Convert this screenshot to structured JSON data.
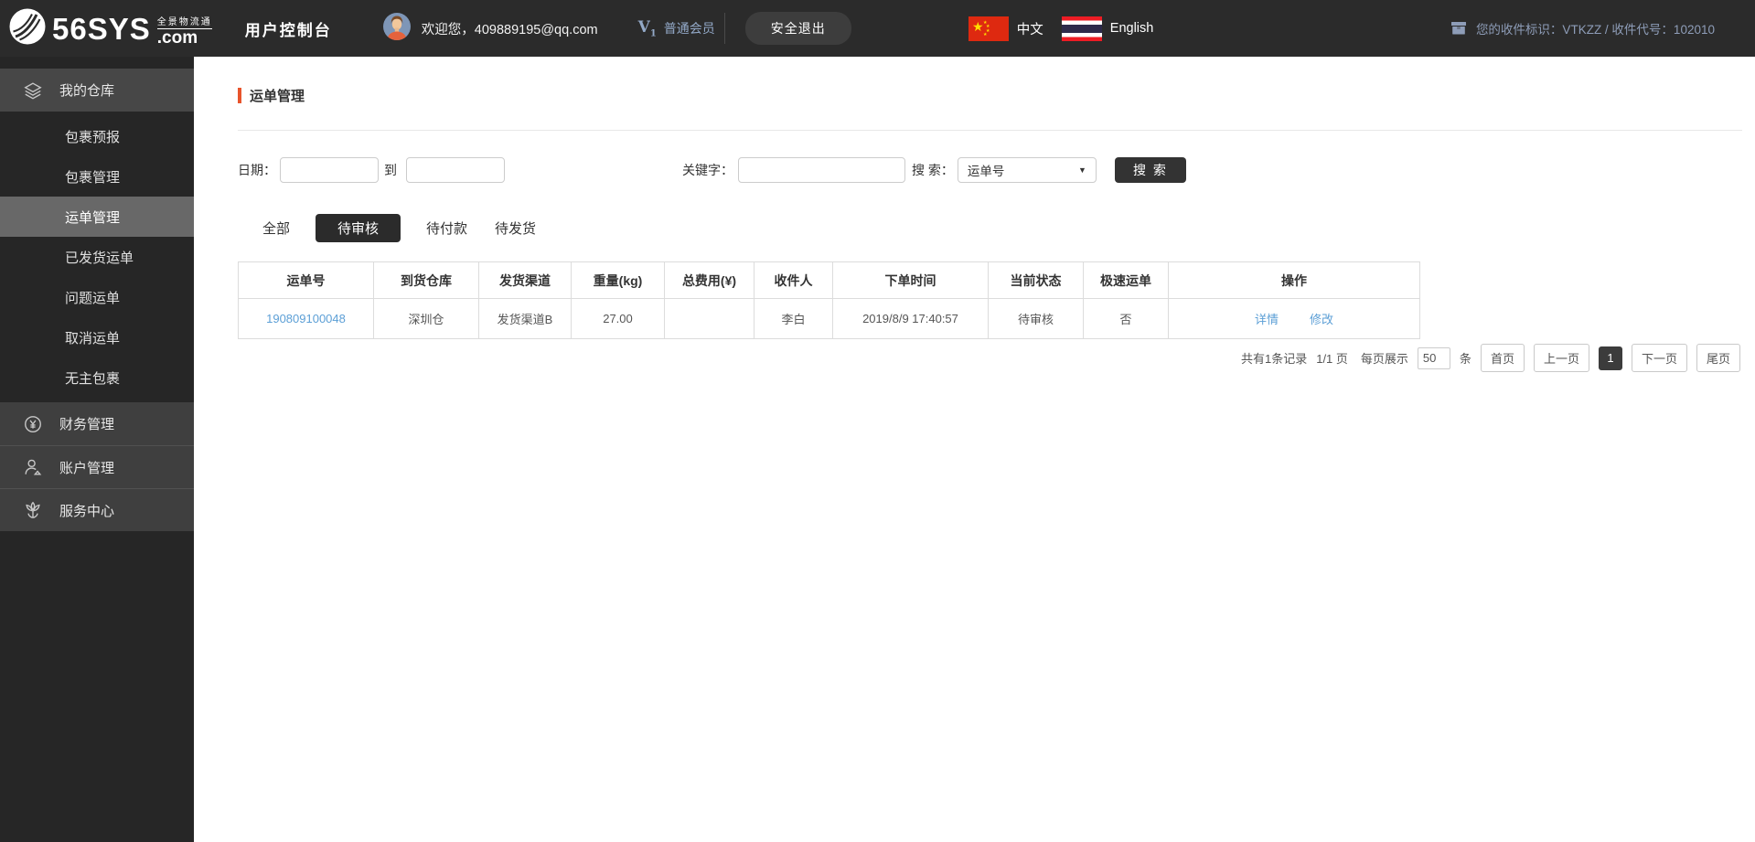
{
  "header": {
    "logo": {
      "main": "56SYS",
      "tagline": "全景物流通",
      "com": ".com"
    },
    "console_title": "用户控制台",
    "welcome": "欢迎您，409889195@qq.com",
    "member": {
      "badge": "V",
      "badge_sub": "1",
      "label": "普通会员"
    },
    "logout_label": "安全退出",
    "lang_zh": "中文",
    "lang_en": "English",
    "receiver_info": "您的收件标识：VTKZZ / 收件代号：102010"
  },
  "sidebar": {
    "groups": [
      {
        "label": "我的仓库",
        "icon": "layers-icon",
        "items": [
          "包裹预报",
          "包裹管理",
          "运单管理",
          "已发货运单",
          "问题运单",
          "取消运单",
          "无主包裹"
        ],
        "active_item": "运单管理"
      },
      {
        "label": "财务管理",
        "icon": "yen-circle-icon"
      },
      {
        "label": "账户管理",
        "icon": "person-icon"
      },
      {
        "label": "服务中心",
        "icon": "lotus-icon"
      }
    ]
  },
  "main": {
    "page_title": "运单管理",
    "filters": {
      "date_label": "日期：",
      "to_label": "到",
      "keyword_label": "关键字：",
      "search_label": "搜 索：",
      "search_type_selected": "运单号",
      "search_button_label": "搜 索",
      "date_from_value": "",
      "date_to_value": "",
      "keyword_value": ""
    },
    "tabs": [
      {
        "label": "全部",
        "active": false
      },
      {
        "label": "待审核",
        "active": true
      },
      {
        "label": "待付款",
        "active": false
      },
      {
        "label": "待发货",
        "active": false
      }
    ],
    "table": {
      "columns": [
        "运单号",
        "到货仓库",
        "发货渠道",
        "重量(kg)",
        "总费用(¥)",
        "收件人",
        "下单时间",
        "当前状态",
        "极速运单",
        "操作"
      ],
      "rows": [
        {
          "waybill_no": "190809100048",
          "warehouse": "深圳仓",
          "channel": "发货渠道B",
          "weight": "27.00",
          "total_fee": "",
          "receiver": "李白",
          "order_time": "2019/8/9 17:40:57",
          "status": "待审核",
          "express": "否",
          "actions": [
            "详情",
            "修改"
          ]
        }
      ]
    },
    "pagination": {
      "summary": "共有1条记录",
      "page_info": "1/1 页",
      "per_page_label": "每页展示",
      "per_page_value": "50",
      "unit_label": "条",
      "first_label": "首页",
      "prev_label": "上一页",
      "current_page": "1",
      "next_label": "下一页",
      "last_label": "尾页"
    }
  },
  "colors": {
    "header_bg": "#2b2b2b",
    "sidebar_bg": "#262626",
    "group_row_bg": "#474747",
    "active_item_bg": "#686868",
    "accent_red": "#e8542c",
    "link_blue": "#5c9fd6",
    "member_text": "#93a9c8",
    "receiver_text": "#8e9db8",
    "china_flag_red": "#de2910",
    "thai_flag_blue": "#2d2a4a"
  }
}
